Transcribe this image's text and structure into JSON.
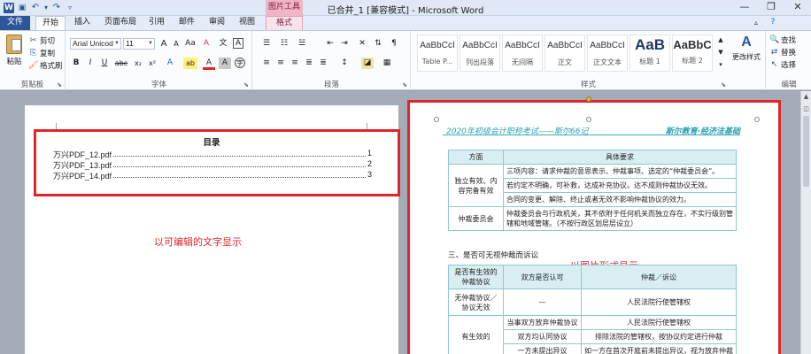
{
  "window": {
    "title": "已合并_1 [兼容模式] - Microsoft Word",
    "contextual_group": "图片工具",
    "controls": {
      "minimize": "—",
      "restore": "❐",
      "close": "✕"
    }
  },
  "quick_access": {
    "app_icon": "W",
    "save_icon": "💾",
    "undo_icon": "↶",
    "undo_dd": "▾",
    "redo_icon": "↷",
    "customize_icon": "⇩"
  },
  "tabs": [
    "文件",
    "开始",
    "插入",
    "页面布局",
    "引用",
    "邮件",
    "审阅",
    "视图",
    "格式"
  ],
  "ribbon": {
    "clipboard": {
      "label": "剪贴板",
      "paste": "粘贴",
      "cut": "剪切",
      "copy": "复制",
      "format_painter": "格式刷"
    },
    "font": {
      "label": "字体",
      "font_name": "Arial Unicod",
      "font_size": "11",
      "grow": "A",
      "shrink": "A",
      "change_case": "Aa",
      "clear_format": "A",
      "bold": "B",
      "italic": "I",
      "underline": "U",
      "strike": "abc",
      "subscript": "x₂",
      "superscript": "x²",
      "effects": "A",
      "highlight": "ab",
      "color": "A",
      "char_shading": "A",
      "enclose": "字"
    },
    "paragraph": {
      "label": "段落"
    },
    "styles": {
      "label": "样式",
      "tiles": [
        {
          "sample": "AaBbCcI",
          "name": "Table P..."
        },
        {
          "sample": "AaBbCcI",
          "name": "列出段落"
        },
        {
          "sample": "AaBbCcI",
          "name": "无间隔"
        },
        {
          "sample": "AaBbCcI",
          "name": "正文"
        },
        {
          "sample": "AaBbCcI",
          "name": "正文文本"
        },
        {
          "sample": "AaB",
          "name": "标题 1"
        },
        {
          "sample": "AaBbC",
          "name": "标题 2"
        }
      ],
      "change_styles": "更改样式"
    },
    "editing": {
      "label": "编辑",
      "find": "查找",
      "replace": "替换",
      "select": "选择"
    }
  },
  "left_page": {
    "toc_title": "目录",
    "toc": [
      {
        "text": "万兴PDF_12.pdf",
        "page": "1"
      },
      {
        "text": "万兴PDF_13.pdf",
        "page": "2"
      },
      {
        "text": "万兴PDF_14.pdf",
        "page": "3"
      }
    ],
    "annotation": "以可编辑的文字显示"
  },
  "right_page": {
    "annotation": "以图片形式显示",
    "image": {
      "header_left": "2020年初级会计职称考试——斯尔66记",
      "header_right": "斯尔教育·经济法基础",
      "table1": {
        "headers": [
          "方面",
          "具体要求"
        ],
        "rows": [
          {
            "side": "独立有效、内容完备有效",
            "items": [
              "三项内容：请求仲裁的意思表示、仲裁事项、选定的“仲裁委员会”。",
              "若约定不明确，可补救，达成补充协议。达不成则仲裁协议无效。",
              "合同的变更、解除、终止或者无效不影响仲裁协议的效力。"
            ]
          },
          {
            "side": "仲裁委员会",
            "items": [
              "仲裁委员会与行政机关，其不依附于任何机关而独立存在，不实行级别管辖和地域管辖。（不按行政区划层层设立）"
            ]
          }
        ]
      },
      "section3": "三、是否可无视仲裁而诉讼",
      "table2": {
        "headers": [
          "是否有生效的仲裁协议",
          "双方是否认可",
          "仲裁／诉讼"
        ],
        "rows": [
          [
            "无仲裁协议／协议无效",
            "—",
            "人民法院行使管辖权"
          ],
          [
            "",
            "当事双方放弃仲裁协议",
            "人民法院行使管辖权"
          ],
          [
            "有生效的",
            "双方均认同协议",
            "排除法院的管辖权，按协议约定进行仲裁"
          ],
          [
            "",
            "一方未提出异议",
            "如一方在首次开庭前未提出异议，视为放弃仲裁"
          ]
        ]
      }
    }
  }
}
